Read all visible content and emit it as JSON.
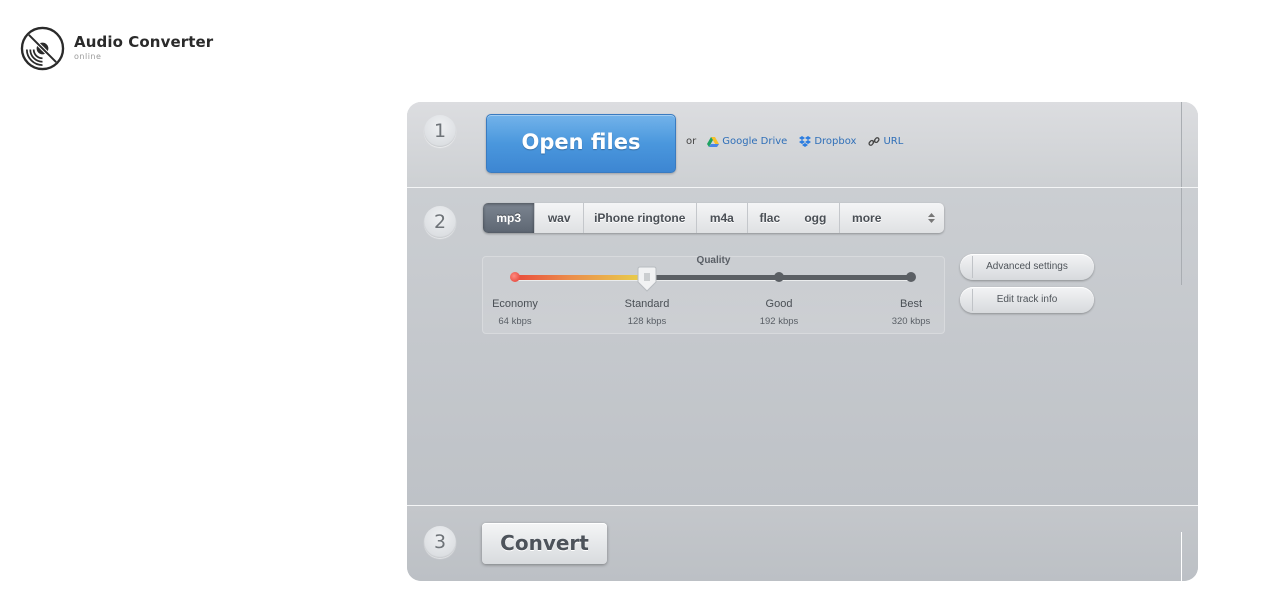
{
  "app": {
    "title": "Audio Converter",
    "subtitle": "online",
    "logo_icon": "disc-no-sound-icon"
  },
  "steps": [
    {
      "number": "1"
    },
    {
      "number": "2"
    },
    {
      "number": "3"
    }
  ],
  "step1": {
    "open_files_label": "Open files",
    "or_label": "or",
    "sources": [
      {
        "label": "Google Drive",
        "icon": "google-drive-icon"
      },
      {
        "label": "Dropbox",
        "icon": "dropbox-icon"
      },
      {
        "label": "URL",
        "icon": "link-icon"
      }
    ]
  },
  "step2": {
    "formats": [
      {
        "label": "mp3",
        "active": true
      },
      {
        "label": "wav",
        "active": false
      },
      {
        "label": "iPhone ringtone",
        "active": false
      },
      {
        "label": "m4a",
        "active": false
      },
      {
        "label": "flac",
        "active": false
      },
      {
        "label": "ogg",
        "active": false
      },
      {
        "label": "more",
        "active": false
      }
    ],
    "quality": {
      "title": "Quality",
      "selected_index": 1,
      "levels": [
        {
          "label": "Economy",
          "bitrate": "64 kbps"
        },
        {
          "label": "Standard",
          "bitrate": "128 kbps"
        },
        {
          "label": "Good",
          "bitrate": "192 kbps"
        },
        {
          "label": "Best",
          "bitrate": "320 kbps"
        }
      ]
    },
    "advanced_settings_label": "Advanced settings",
    "edit_track_info_label": "Edit track info"
  },
  "step3": {
    "convert_label": "Convert"
  },
  "colors": {
    "primary_button": "#4a97dd",
    "active_tab": "#6a737f",
    "link": "#2f6fb8"
  }
}
